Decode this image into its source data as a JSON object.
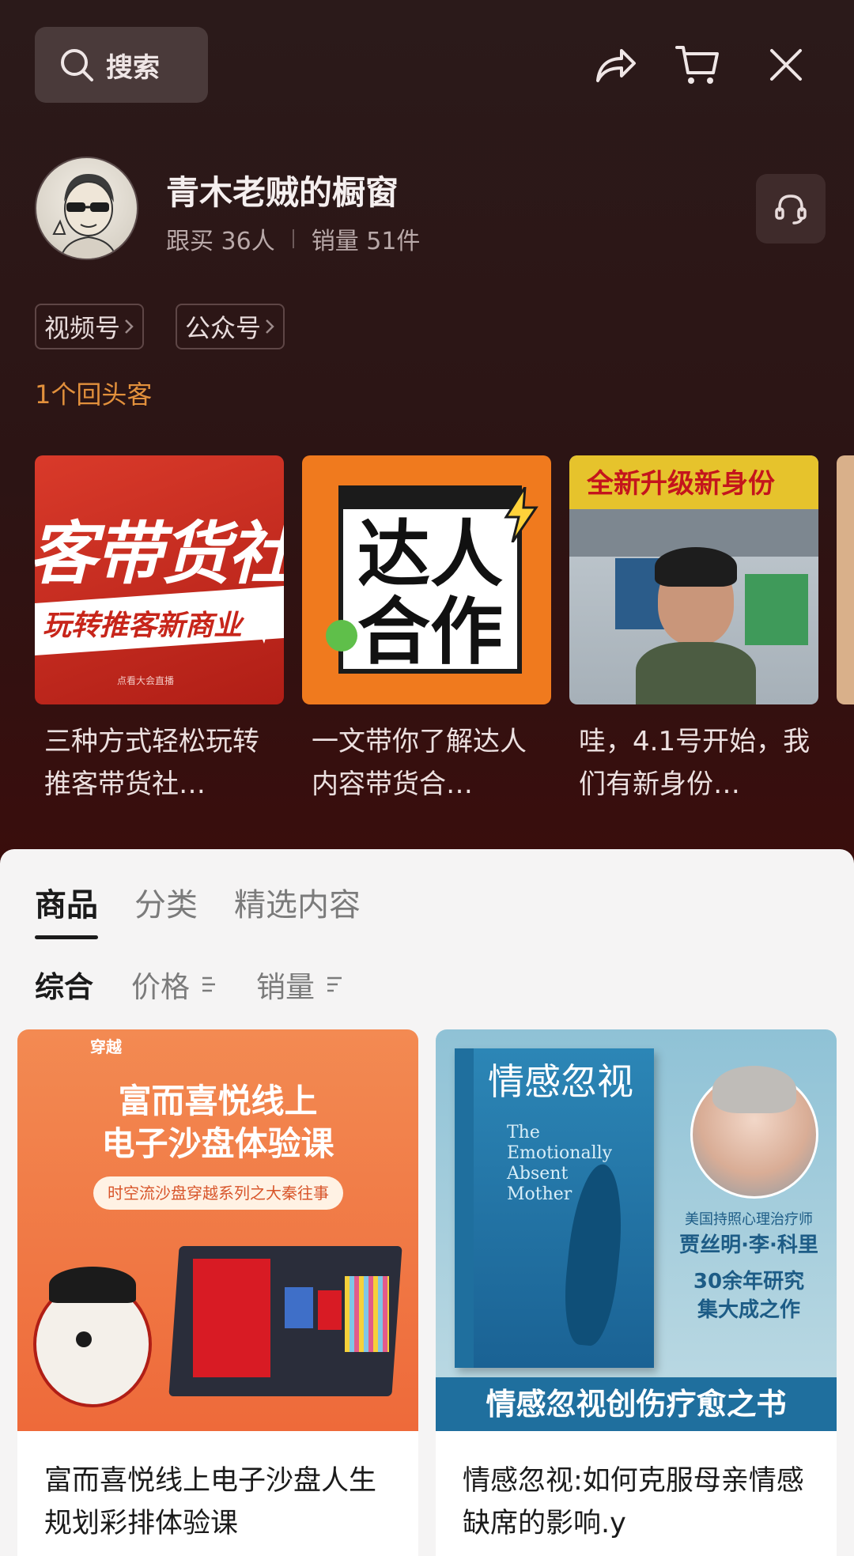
{
  "search": {
    "label": "搜索"
  },
  "store": {
    "name": "青木老贼的橱窗",
    "followers": "跟买 36人",
    "sales": "销量 51件"
  },
  "chips": [
    {
      "label": "视频号"
    },
    {
      "label": "公众号"
    }
  ],
  "returning": "1个回头客",
  "videos": [
    {
      "title": "三种方式轻松玩转推客带货社…",
      "thumb_text_1": "客带货社",
      "thumb_text_2": "玩转推客新商业",
      "thumb_text_3": "点看大会直播"
    },
    {
      "title": "一文带你了解达人内容带货合…",
      "thumb_text_1": "达人",
      "thumb_text_2": "合作"
    },
    {
      "title": "哇，4.1号开始，我们有新身份…",
      "thumb_text_1": "全新升级新身份"
    }
  ],
  "tabs": [
    {
      "label": "商品",
      "active": true
    },
    {
      "label": "分类",
      "active": false
    },
    {
      "label": "精选内容",
      "active": false
    }
  ],
  "sorts": [
    {
      "label": "综合",
      "active": true
    },
    {
      "label": "价格",
      "active": false
    },
    {
      "label": "销量",
      "active": false
    }
  ],
  "products": [
    {
      "title": "富而喜悦线上电子沙盘人生规划彩排体验课",
      "img_line_1": "富而喜悦线上",
      "img_line_2": "电子沙盘体验课",
      "img_tag": "时空流沙盘穿越系列之大秦往事",
      "img_brand": "穿越"
    },
    {
      "title": "情感忽视:如何克服母亲情感缺席的影响.y",
      "img_book_title": "情感忽视",
      "img_book_en_1": "The",
      "img_book_en_2": "Emotionally",
      "img_book_en_3": "Absent",
      "img_book_en_4": "Mother",
      "img_author_role": "美国持照心理治疗师",
      "img_author": "贾丝明·李·科里",
      "img_claim_1": "30余年研究",
      "img_claim_2": "集大成之作",
      "img_banner": "情感忽视创伤疗愈之书"
    }
  ],
  "colors": {
    "accent_orange": "#e2903c",
    "header_bg": "#2c1414",
    "panel_bg": "#f5f4f4"
  }
}
